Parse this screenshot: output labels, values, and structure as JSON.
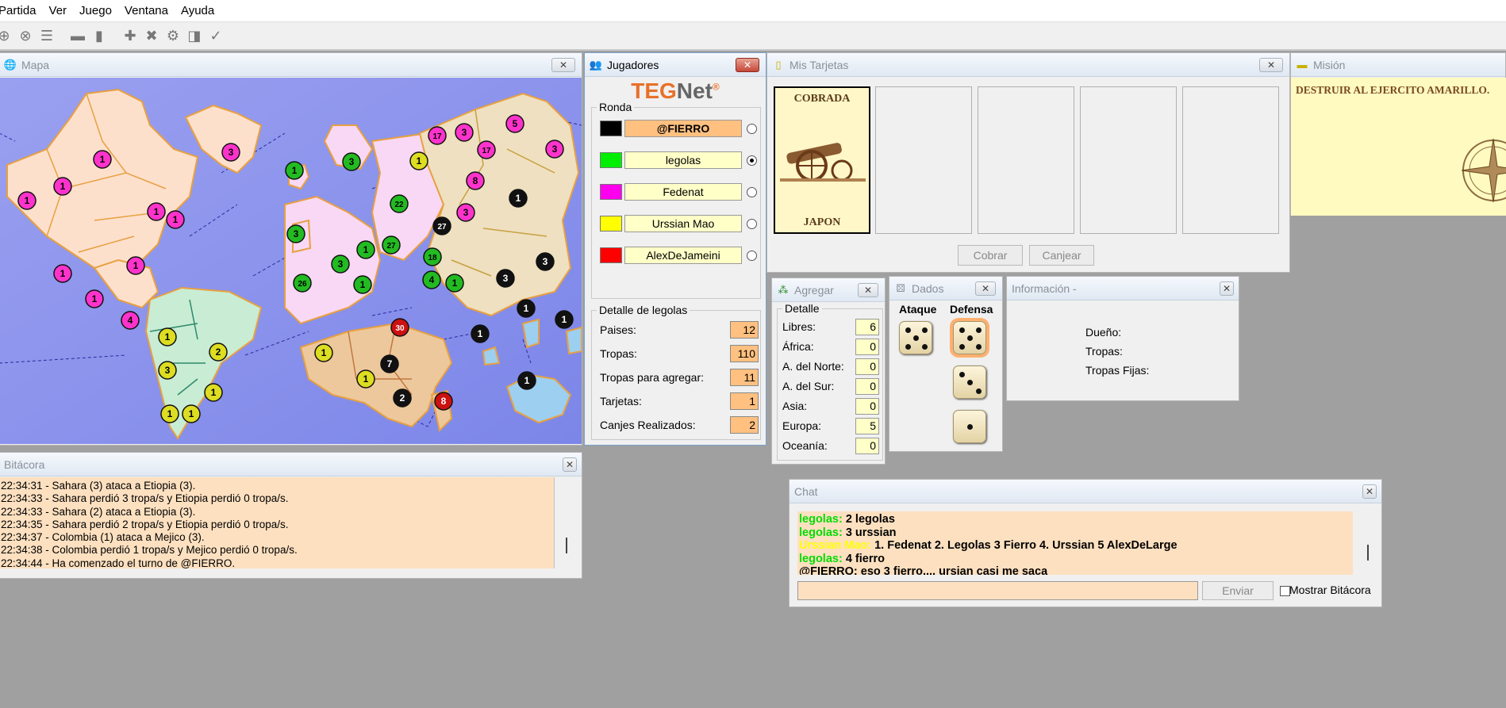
{
  "menu": [
    "Partida",
    "Ver",
    "Juego",
    "Ventana",
    "Ayuda"
  ],
  "toolbar_icons": [
    "connect-icon",
    "disconnect-icon",
    "list-icon",
    "window-icon",
    "window-icon",
    "add-icon",
    "delete-icon",
    "gear-icon",
    "copy-icon",
    "check-icon"
  ],
  "map": {
    "title": "Mapa",
    "markers": [
      {
        "country": "NA1",
        "value": "1",
        "color": "#ff33cc"
      },
      {
        "country": "NA2",
        "value": "1",
        "color": "#ff33cc"
      },
      {
        "country": "NA3",
        "value": "1",
        "color": "#ff33cc"
      },
      {
        "country": "NA4",
        "value": "1",
        "color": "#ff33cc"
      },
      {
        "country": "NA5",
        "value": "1",
        "color": "#ff33cc"
      },
      {
        "country": "NA6",
        "value": "1",
        "color": "#ff33cc"
      },
      {
        "country": "NA7",
        "value": "1",
        "color": "#ff33cc"
      },
      {
        "country": "NA8",
        "value": "1",
        "color": "#ff33cc"
      },
      {
        "country": "NA9",
        "value": "4",
        "color": "#ff33cc"
      },
      {
        "country": "GR",
        "value": "3",
        "color": "#ff33cc"
      },
      {
        "country": "SA1",
        "value": "1",
        "color": "#dddd22"
      },
      {
        "country": "SA2",
        "value": "2",
        "color": "#dddd22"
      },
      {
        "country": "SA3",
        "value": "3",
        "color": "#dddd22"
      },
      {
        "country": "SA4",
        "value": "1",
        "color": "#dddd22"
      },
      {
        "country": "SA5",
        "value": "1",
        "color": "#dddd22"
      },
      {
        "country": "SA6",
        "value": "1",
        "color": "#dddd22"
      },
      {
        "country": "EU1",
        "value": "1",
        "color": "#22bb22"
      },
      {
        "country": "EU2",
        "value": "3",
        "color": "#22bb22"
      },
      {
        "country": "EU3",
        "value": "3",
        "color": "#22bb22"
      },
      {
        "country": "EU4",
        "value": "22",
        "color": "#22bb22"
      },
      {
        "country": "EU5",
        "value": "1",
        "color": "#22bb22"
      },
      {
        "country": "EU6",
        "value": "27",
        "color": "#22bb22"
      },
      {
        "country": "EU7",
        "value": "3",
        "color": "#22bb22"
      },
      {
        "country": "EU8",
        "value": "26",
        "color": "#22bb22"
      },
      {
        "country": "EU9",
        "value": "1",
        "color": "#22bb22"
      },
      {
        "country": "AS1",
        "value": "17",
        "color": "#ff33cc"
      },
      {
        "country": "AS2",
        "value": "3",
        "color": "#ff33cc"
      },
      {
        "country": "AS3",
        "value": "17",
        "color": "#ff33cc"
      },
      {
        "country": "AS4",
        "value": "5",
        "color": "#ff33cc"
      },
      {
        "country": "AS5",
        "value": "3",
        "color": "#ff33cc"
      },
      {
        "country": "AS6",
        "value": "8",
        "color": "#ff33cc"
      },
      {
        "country": "AS7",
        "value": "3",
        "color": "#ff33cc"
      },
      {
        "country": "AS8",
        "value": "1",
        "color": "#dddd22"
      },
      {
        "country": "AS9",
        "value": "27",
        "color": "#111111"
      },
      {
        "country": "AS10",
        "value": "1",
        "color": "#111111"
      },
      {
        "country": "AS11",
        "value": "3",
        "color": "#111111"
      },
      {
        "country": "AS12",
        "value": "3",
        "color": "#111111"
      },
      {
        "country": "AS13",
        "value": "18",
        "color": "#22bb22"
      },
      {
        "country": "AS14",
        "value": "4",
        "color": "#22bb22"
      },
      {
        "country": "AS15",
        "value": "1",
        "color": "#22bb22"
      },
      {
        "country": "AF1",
        "value": "1",
        "color": "#dddd22"
      },
      {
        "country": "AF2",
        "value": "30",
        "color": "#cc1111"
      },
      {
        "country": "AF3",
        "value": "7",
        "color": "#111111"
      },
      {
        "country": "AF4",
        "value": "1",
        "color": "#dddd22"
      },
      {
        "country": "AF5",
        "value": "2",
        "color": "#111111"
      },
      {
        "country": "AF6",
        "value": "8",
        "color": "#cc1111"
      },
      {
        "country": "OC1",
        "value": "1",
        "color": "#111111"
      },
      {
        "country": "OC2",
        "value": "1",
        "color": "#111111"
      },
      {
        "country": "OC3",
        "value": "1",
        "color": "#111111"
      },
      {
        "country": "OC4",
        "value": "1",
        "color": "#111111"
      }
    ]
  },
  "players": {
    "title": "Jugadores",
    "logo_teg": "TEG",
    "logo_net": "Net",
    "logo_reg": "®",
    "ronda_label": "Ronda",
    "list": [
      {
        "name": "@FIERRO",
        "color": "#000000",
        "active": true,
        "selected": false
      },
      {
        "name": "legolas",
        "color": "#00ee00",
        "active": false,
        "selected": true
      },
      {
        "name": "Fedenat",
        "color": "#ff00ee",
        "active": false,
        "selected": false
      },
      {
        "name": "Urssian Mao",
        "color": "#ffff00",
        "active": false,
        "selected": false
      },
      {
        "name": "AlexDeJameini",
        "color": "#ff0000",
        "active": false,
        "selected": false
      }
    ],
    "detail_label": "Detalle de legolas",
    "detail": [
      {
        "label": "Paises:",
        "value": "12"
      },
      {
        "label": "Tropas:",
        "value": "110"
      },
      {
        "label": "Tropas para agregar:",
        "value": "11"
      },
      {
        "label": "Tarjetas:",
        "value": "1"
      },
      {
        "label": "Canjes Realizados:",
        "value": "2"
      }
    ]
  },
  "cards": {
    "title": "Mis Tarjetas",
    "card_title": "COBRADA",
    "card_country": "JAPON",
    "cobrar": "Cobrar",
    "canjear": "Canjear"
  },
  "mission": {
    "title": "Misión",
    "text": "DESTRUIR AL EJERCITO AMARILLO."
  },
  "agregar": {
    "title": "Agregar",
    "detail_label": "Detalle",
    "rows": [
      {
        "label": "Libres:",
        "value": "6"
      },
      {
        "label": "África:",
        "value": "0"
      },
      {
        "label": "A. del Norte:",
        "value": "0"
      },
      {
        "label": "A. del Sur:",
        "value": "0"
      },
      {
        "label": "Asia:",
        "value": "0"
      },
      {
        "label": "Europa:",
        "value": "5"
      },
      {
        "label": "Oceanía:",
        "value": "0"
      }
    ]
  },
  "dados": {
    "title": "Dados",
    "ataque": "Ataque",
    "defensa": "Defensa",
    "attack_dice": [
      5
    ],
    "defense_dice": [
      5,
      3,
      1
    ]
  },
  "info": {
    "title": "Información -",
    "labels": [
      "Dueño:",
      "Tropas:",
      "Tropas Fijas:"
    ]
  },
  "bitacora": {
    "title": "Bitácora",
    "lines": [
      "22:34:31 - Sahara (3) ataca a Etiopia (3).",
      "22:34:33 - Sahara perdió 3 tropa/s y Etiopia perdió 0 tropa/s.",
      "22:34:33 - Sahara (2) ataca a Etiopia (3).",
      "22:34:35 - Sahara perdió 2 tropa/s y Etiopia perdió 0 tropa/s.",
      "22:34:37 - Colombia (1) ataca a Mejico (3).",
      "22:34:38 - Colombia perdió 1 tropa/s y Mejico perdió 0 tropa/s.",
      "22:34:44 - Ha comenzado el turno de @FIERRO."
    ]
  },
  "chat": {
    "title": "Chat",
    "messages": [
      {
        "user": "legolas:",
        "text": " 2 legolas",
        "color": "#00dd00"
      },
      {
        "user": "legolas:",
        "text": " 3 urssian",
        "color": "#00dd00"
      },
      {
        "user": "Urssian Mao:",
        "text": " 1. Fedenat 2. Legolas 3 Fierro 4. Urssian 5 AlexDeLarge",
        "color": "#ffff00"
      },
      {
        "user": "legolas:",
        "text": " 4 fierro",
        "color": "#00dd00"
      },
      {
        "user": "@FIERRO:",
        "text": " eso 3 fierro.... ursian casi me saca",
        "color": "#000000"
      }
    ],
    "send": "Enviar",
    "show_log": "Mostrar Bitácora"
  }
}
